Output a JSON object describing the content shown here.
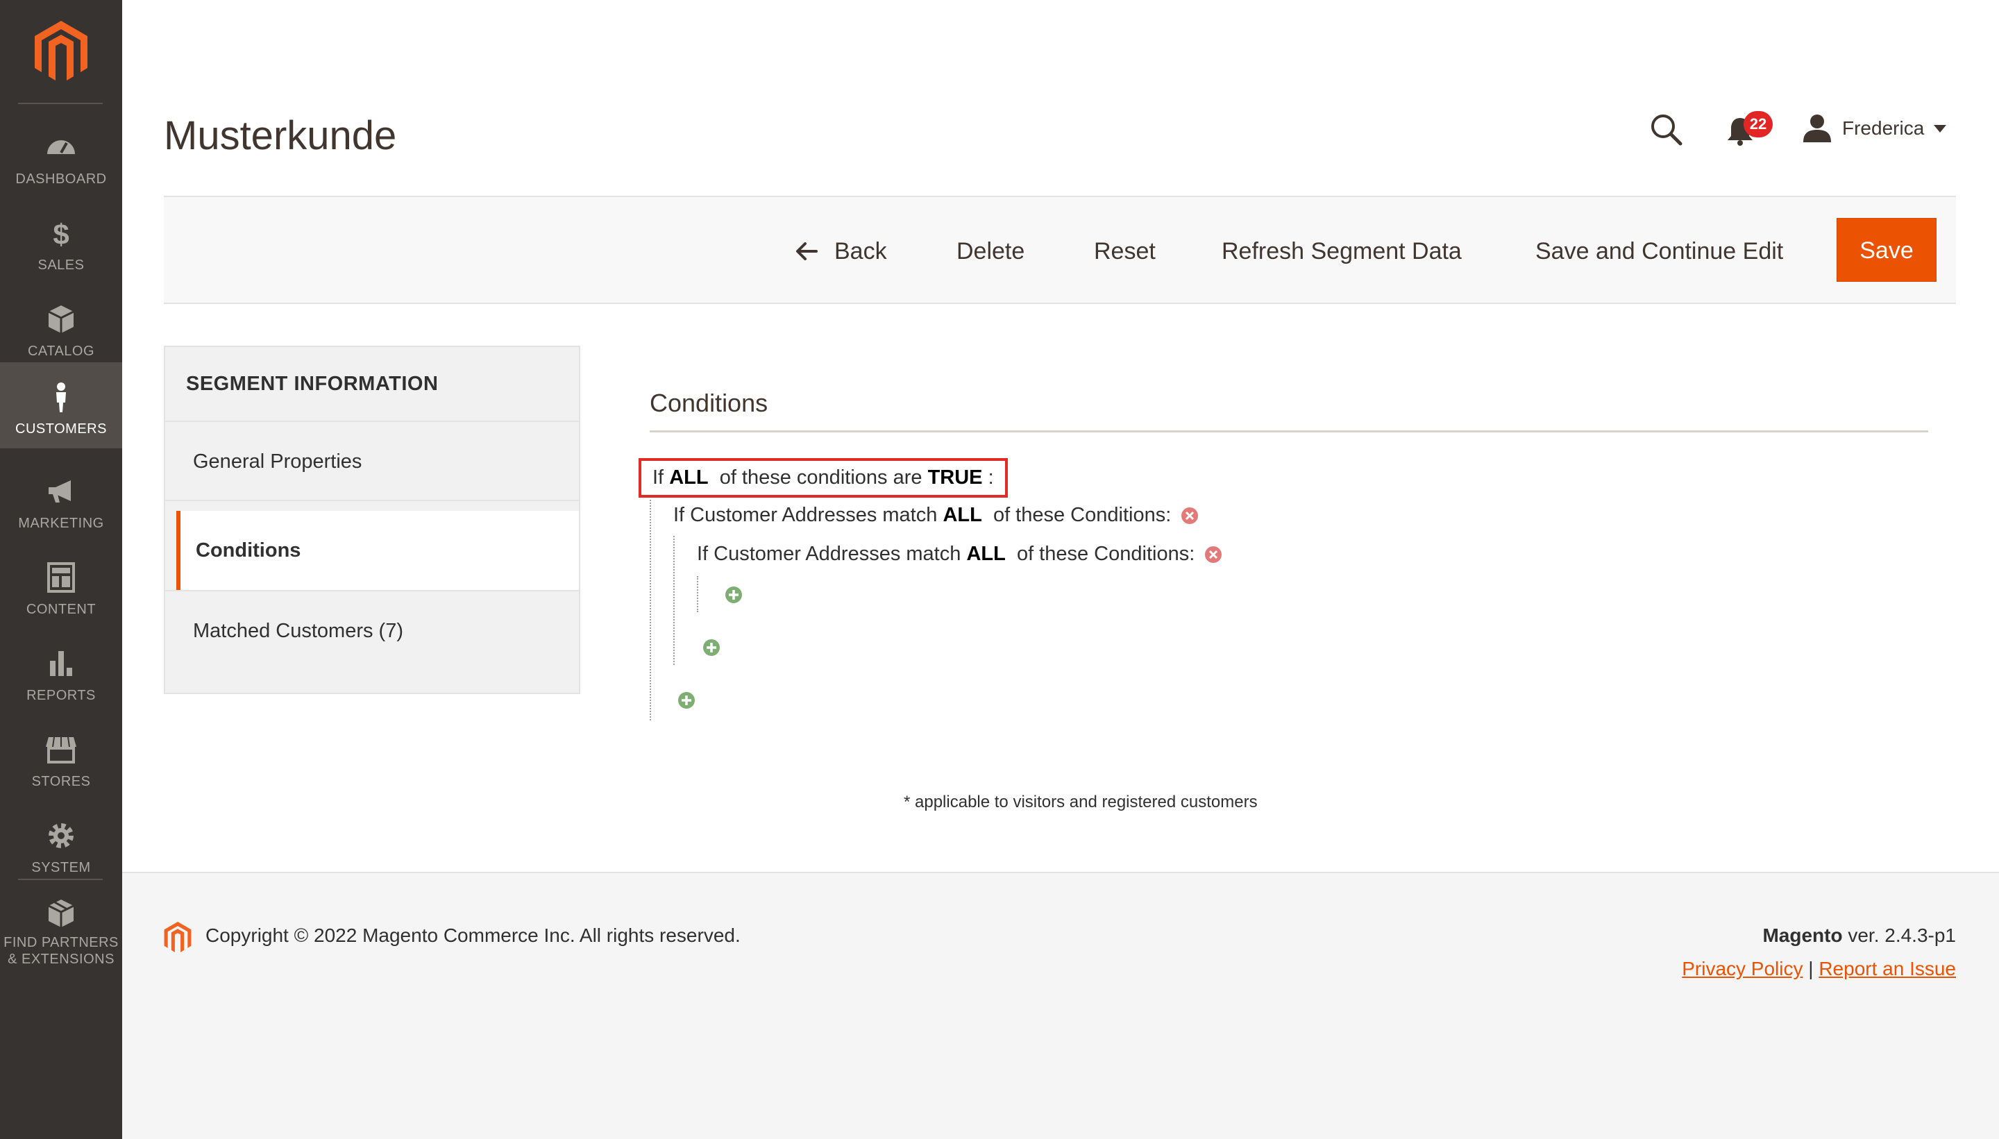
{
  "sidebar": {
    "logo": "magento-logo",
    "items": [
      {
        "label": "DASHBOARD",
        "icon": "dashboard-gauge-icon"
      },
      {
        "label": "SALES",
        "icon": "dollar-icon"
      },
      {
        "label": "CATALOG",
        "icon": "box-icon"
      },
      {
        "label": "CUSTOMERS",
        "icon": "person-icon",
        "active": true
      },
      {
        "label": "MARKETING",
        "icon": "megaphone-icon"
      },
      {
        "label": "CONTENT",
        "icon": "layout-icon"
      },
      {
        "label": "REPORTS",
        "icon": "bar-chart-icon"
      },
      {
        "label": "STORES",
        "icon": "storefront-icon"
      },
      {
        "label": "SYSTEM",
        "icon": "gear-icon"
      },
      {
        "label": "FIND PARTNERS",
        "label2": "& EXTENSIONS",
        "icon": "extensions-box-icon"
      }
    ]
  },
  "header": {
    "title": "Musterkunde",
    "notifications_count": "22",
    "user_name": "Frederica"
  },
  "actions": {
    "back": "Back",
    "delete": "Delete",
    "reset": "Reset",
    "refresh": "Refresh Segment Data",
    "save_continue": "Save and Continue Edit",
    "save": "Save"
  },
  "tabs": {
    "header": "SEGMENT INFORMATION",
    "general": "General Properties",
    "conditions": "Conditions",
    "matched": "Matched Customers (7)"
  },
  "conditions": {
    "title": "Conditions",
    "top": {
      "pre": "If",
      "aggregator": "ALL",
      "mid": "of these conditions are",
      "value": "TRUE",
      "post": ":"
    },
    "level1": {
      "pre": "If Customer Addresses match",
      "aggregator": "ALL",
      "post": "of these Conditions:"
    },
    "level2": {
      "pre": "If Customer Addresses match",
      "aggregator": "ALL",
      "post": "of these Conditions:"
    },
    "note": "* applicable to visitors and registered customers"
  },
  "footer": {
    "copyright": "Copyright © 2022 Magento Commerce Inc. All rights reserved.",
    "brand": "Magento",
    "version": "ver. 2.4.3-p1",
    "privacy": "Privacy Policy",
    "separator": "|",
    "report": "Report an Issue"
  },
  "colors": {
    "accent": "#eb5202",
    "sidebar_bg": "#373330",
    "highlight_border": "#e02b27"
  }
}
